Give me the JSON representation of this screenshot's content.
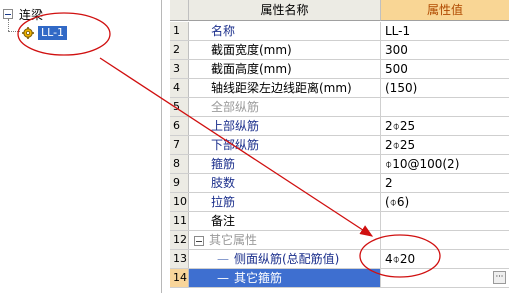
{
  "tree": {
    "root_label": "连梁",
    "child_label": "LL-1"
  },
  "grid": {
    "col_name_header": "属性名称",
    "col_value_header": "属性值",
    "rows": [
      {
        "num": "1",
        "name": "名称",
        "value": "LL-1"
      },
      {
        "num": "2",
        "name": "截面宽度(mm)",
        "value": "300"
      },
      {
        "num": "3",
        "name": "截面高度(mm)",
        "value": "500"
      },
      {
        "num": "4",
        "name": "轴线距梁左边线距离(mm)",
        "value": "(150)"
      },
      {
        "num": "5",
        "name": "全部纵筋",
        "value": ""
      },
      {
        "num": "6",
        "name": "上部纵筋",
        "value": "2⌽25"
      },
      {
        "num": "7",
        "name": "下部纵筋",
        "value": "2⌽25"
      },
      {
        "num": "8",
        "name": "箍筋",
        "value": "⌽10@100(2)"
      },
      {
        "num": "9",
        "name": "肢数",
        "value": "2"
      },
      {
        "num": "10",
        "name": "拉筋",
        "value": "(⌽6)"
      },
      {
        "num": "11",
        "name": "备注",
        "value": ""
      },
      {
        "num": "12",
        "name": "其它属性",
        "value": ""
      },
      {
        "num": "13",
        "name": "侧面纵筋(总配筋值)",
        "value": "4⌽20"
      },
      {
        "num": "14",
        "name": "其它箍筋",
        "value": ""
      }
    ],
    "ellipsis_button": "···"
  },
  "colors": {
    "accent_header": "#f9d695",
    "selection": "#3e6fd0",
    "annotation": "#d01010"
  }
}
